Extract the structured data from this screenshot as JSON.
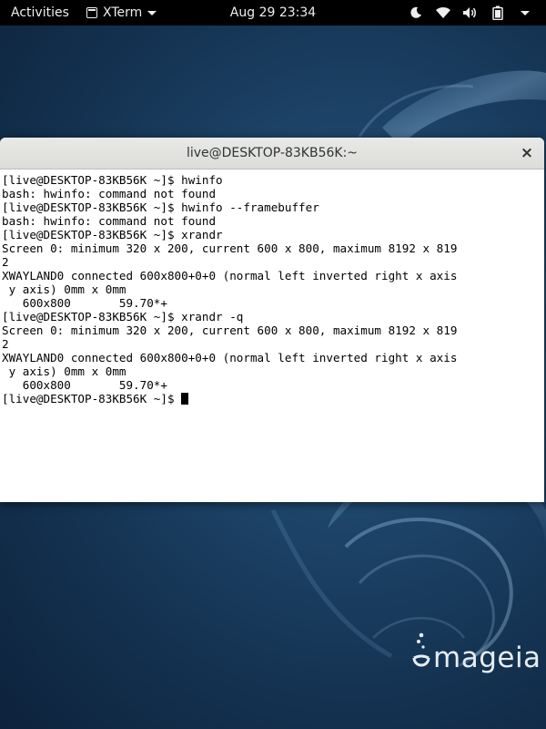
{
  "topbar": {
    "activities_label": "Activities",
    "app_name": "XTerm",
    "clock": "Aug 29  23:34",
    "tray_icons": [
      "night-light-icon",
      "wifi-icon",
      "volume-icon",
      "battery-icon",
      "system-menu-caret-icon"
    ]
  },
  "terminal": {
    "title": "live@DESKTOP-83KB56K:~",
    "close_label": "×",
    "lines": [
      "[live@DESKTOP-83KB56K ~]$ hwinfo",
      "bash: hwinfo: command not found",
      "[live@DESKTOP-83KB56K ~]$ hwinfo --framebuffer",
      "bash: hwinfo: command not found",
      "[live@DESKTOP-83KB56K ~]$ xrandr",
      "Screen 0: minimum 320 x 200, current 600 x 800, maximum 8192 x 819",
      "2",
      "XWAYLAND0 connected 600x800+0+0 (normal left inverted right x axis",
      " y axis) 0mm x 0mm",
      "   600x800       59.70*+",
      "[live@DESKTOP-83KB56K ~]$ xrandr -q",
      "Screen 0: minimum 320 x 200, current 600 x 800, maximum 8192 x 819",
      "2",
      "XWAYLAND0 connected 600x800+0+0 (normal left inverted right x axis",
      " y axis) 0mm x 0mm",
      "   600x800       59.70*+"
    ],
    "prompt": "[live@DESKTOP-83KB56K ~]$ "
  },
  "desktop": {
    "logo_text": "mageia"
  },
  "colors": {
    "topbar_bg": "#000000",
    "terminal_bg": "#ffffff",
    "wallpaper_base": "#1d4468"
  }
}
